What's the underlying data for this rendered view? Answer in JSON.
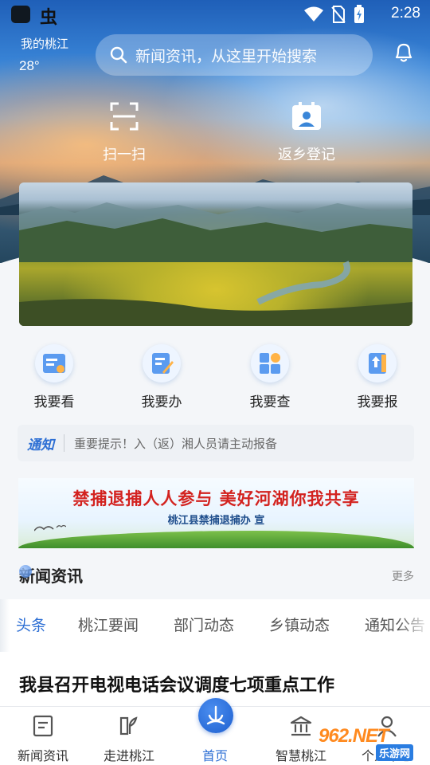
{
  "status": {
    "time": "2:28",
    "app2_glyph": "虫"
  },
  "location": {
    "name": "我的桃江",
    "temperature": "28°"
  },
  "search": {
    "placeholder": "新闻资讯，从这里开始搜索"
  },
  "quick_actions": [
    {
      "label": "扫一扫",
      "icon": "scan-icon"
    },
    {
      "label": "返乡登记",
      "icon": "registration-icon"
    }
  ],
  "services": [
    {
      "label": "我要看",
      "icon": "view-icon"
    },
    {
      "label": "我要办",
      "icon": "handle-icon"
    },
    {
      "label": "我要查",
      "icon": "query-icon"
    },
    {
      "label": "我要报",
      "icon": "report-icon"
    }
  ],
  "notice": {
    "tag": "通知",
    "text": "重要提示！入（返）湘人员请主动报备"
  },
  "ad": {
    "line1": "禁捕退捕人人参与  美好河湖你我共享",
    "line2": "桃江县禁捕退捕办 宣"
  },
  "news": {
    "title": "新闻资讯",
    "more": "更多"
  },
  "tabs": [
    {
      "label": "头条",
      "active": true
    },
    {
      "label": "桃江要闻",
      "active": false
    },
    {
      "label": "部门动态",
      "active": false
    },
    {
      "label": "乡镇动态",
      "active": false
    },
    {
      "label": "通知公告",
      "active": false
    }
  ],
  "headline": "我县召开电视电话会议调度七项重点工作",
  "nav": [
    {
      "label": "新闻资讯",
      "icon": "news-icon",
      "active": false
    },
    {
      "label": "走进桃江",
      "icon": "explore-icon",
      "active": false
    },
    {
      "label": "首页",
      "icon": "home-icon",
      "active": true
    },
    {
      "label": "智慧桃江",
      "icon": "smart-city-icon",
      "active": false
    },
    {
      "label": "个人中心",
      "icon": "user-icon",
      "active": false
    }
  ],
  "watermark": {
    "brand": "962.NET",
    "sub": "乐游网"
  },
  "colors": {
    "accent": "#2d6fd4",
    "ad_red": "#d3221f"
  }
}
